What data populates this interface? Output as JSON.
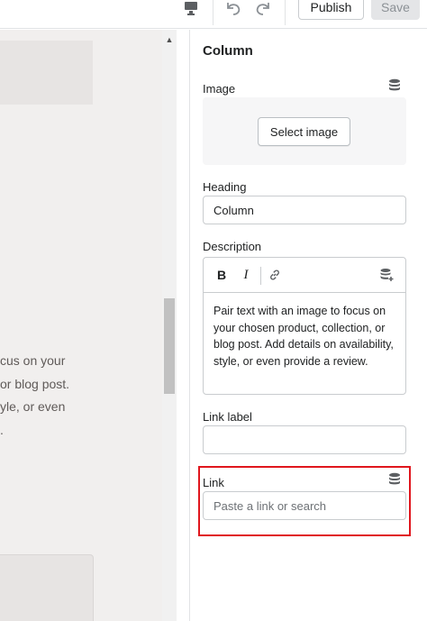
{
  "toolbar": {
    "device_icon": "desktop-preview-icon",
    "undo_icon": "undo-icon",
    "redo_icon": "redo-icon",
    "publish_label": "Publish",
    "save_label": "Save"
  },
  "preview": {
    "text_lines": [
      "cus on your",
      "or blog post.",
      "yle, or even",
      "."
    ]
  },
  "panel": {
    "title": "Column",
    "image": {
      "label": "Image",
      "select_label": "Select image",
      "source_icon": "dynamic-source-icon"
    },
    "heading": {
      "label": "Heading",
      "value": "Column"
    },
    "description": {
      "label": "Description",
      "bold_label": "B",
      "italic_label": "I",
      "link_icon": "link-icon",
      "source_icon": "insert-dynamic-source-icon",
      "body": "Pair text with an image to focus on your chosen product, collection, or blog post. Add details on availability, style, or even provide a review."
    },
    "link_label": {
      "label": "Link label",
      "value": ""
    },
    "link": {
      "label": "Link",
      "placeholder": "Paste a link or search",
      "source_icon": "dynamic-source-icon"
    }
  },
  "colors": {
    "highlight": "#e0161d",
    "preview_bg": "#f1efee"
  }
}
